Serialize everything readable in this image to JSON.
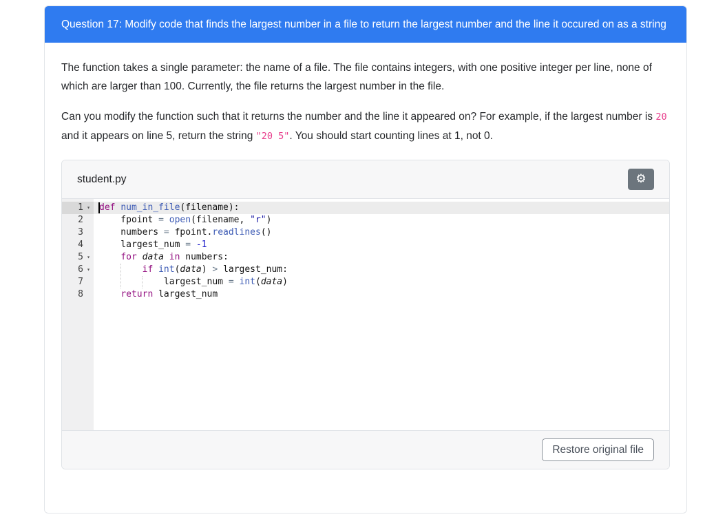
{
  "header": {
    "title": "Question 17: Modify code that finds the largest number in a file to return the largest number and the line it occured on as a string"
  },
  "paragraph1": "The function takes a single parameter: the name of a file. The file contains integers, with one positive integer per line, none of which are larger than 100. Currently, the file returns the largest number in the file.",
  "paragraph2": {
    "part1": "Can you modify the function such that it returns the number and the line it appeared on? For example, if the largest number is ",
    "code1": "20",
    "part2": " and it appears on line 5, return the string ",
    "code2": "\"20 5\"",
    "part3": ". You should start counting lines at 1, not 0."
  },
  "editor": {
    "filename": "student.py",
    "gear_icon": "⚙",
    "fold_icon": "▾",
    "lines": [
      {
        "num": 1,
        "fold": true,
        "active": true,
        "tokens": [
          [
            "kw",
            "def"
          ],
          [
            "txt",
            " "
          ],
          [
            "fn",
            "num_in_file"
          ],
          [
            "txt",
            "(filename):"
          ]
        ]
      },
      {
        "num": 2,
        "fold": false,
        "active": false,
        "tokens": [
          [
            "txt",
            "    fpoint "
          ],
          [
            "op",
            "="
          ],
          [
            "txt",
            " "
          ],
          [
            "fn",
            "open"
          ],
          [
            "txt",
            "(filename, "
          ],
          [
            "str",
            "\"r\""
          ],
          [
            "txt",
            ")"
          ]
        ]
      },
      {
        "num": 3,
        "fold": false,
        "active": false,
        "tokens": [
          [
            "txt",
            "    numbers "
          ],
          [
            "op",
            "="
          ],
          [
            "txt",
            " fpoint."
          ],
          [
            "fn",
            "readlines"
          ],
          [
            "txt",
            "()"
          ]
        ]
      },
      {
        "num": 4,
        "fold": false,
        "active": false,
        "tokens": [
          [
            "txt",
            "    largest_num "
          ],
          [
            "op",
            "="
          ],
          [
            "txt",
            " "
          ],
          [
            "num",
            "-1"
          ]
        ]
      },
      {
        "num": 5,
        "fold": true,
        "active": false,
        "tokens": [
          [
            "txt",
            "    "
          ],
          [
            "kw",
            "for"
          ],
          [
            "txt",
            " "
          ],
          [
            "it",
            "data"
          ],
          [
            "txt",
            " "
          ],
          [
            "kw",
            "in"
          ],
          [
            "txt",
            " numbers:"
          ]
        ]
      },
      {
        "num": 6,
        "fold": true,
        "active": false,
        "tokens": [
          [
            "txt",
            "        "
          ],
          [
            "kw",
            "if"
          ],
          [
            "txt",
            " "
          ],
          [
            "fn",
            "int"
          ],
          [
            "txt",
            "("
          ],
          [
            "it",
            "data"
          ],
          [
            "txt",
            ") "
          ],
          [
            "op",
            ">"
          ],
          [
            "txt",
            " largest_num:"
          ]
        ]
      },
      {
        "num": 7,
        "fold": false,
        "active": false,
        "tokens": [
          [
            "txt",
            "            largest_num "
          ],
          [
            "op",
            "="
          ],
          [
            "txt",
            " "
          ],
          [
            "fn",
            "int"
          ],
          [
            "txt",
            "("
          ],
          [
            "it",
            "data"
          ],
          [
            "txt",
            ")"
          ]
        ]
      },
      {
        "num": 8,
        "fold": false,
        "active": false,
        "tokens": [
          [
            "txt",
            "    "
          ],
          [
            "kw",
            "return"
          ],
          [
            "txt",
            " largest_num"
          ]
        ]
      }
    ]
  },
  "footer": {
    "restore_label": "Restore original file"
  },
  "colors": {
    "header_blue": "#2f7bf0",
    "gear_button_gray": "#6c757d",
    "inline_code_pink": "#e83e8c",
    "keyword": "#930f80",
    "function_name": "#3c5ab4",
    "string": "#1a1aa6",
    "number": "#1c1cc9",
    "operator": "#6b7b8c"
  }
}
